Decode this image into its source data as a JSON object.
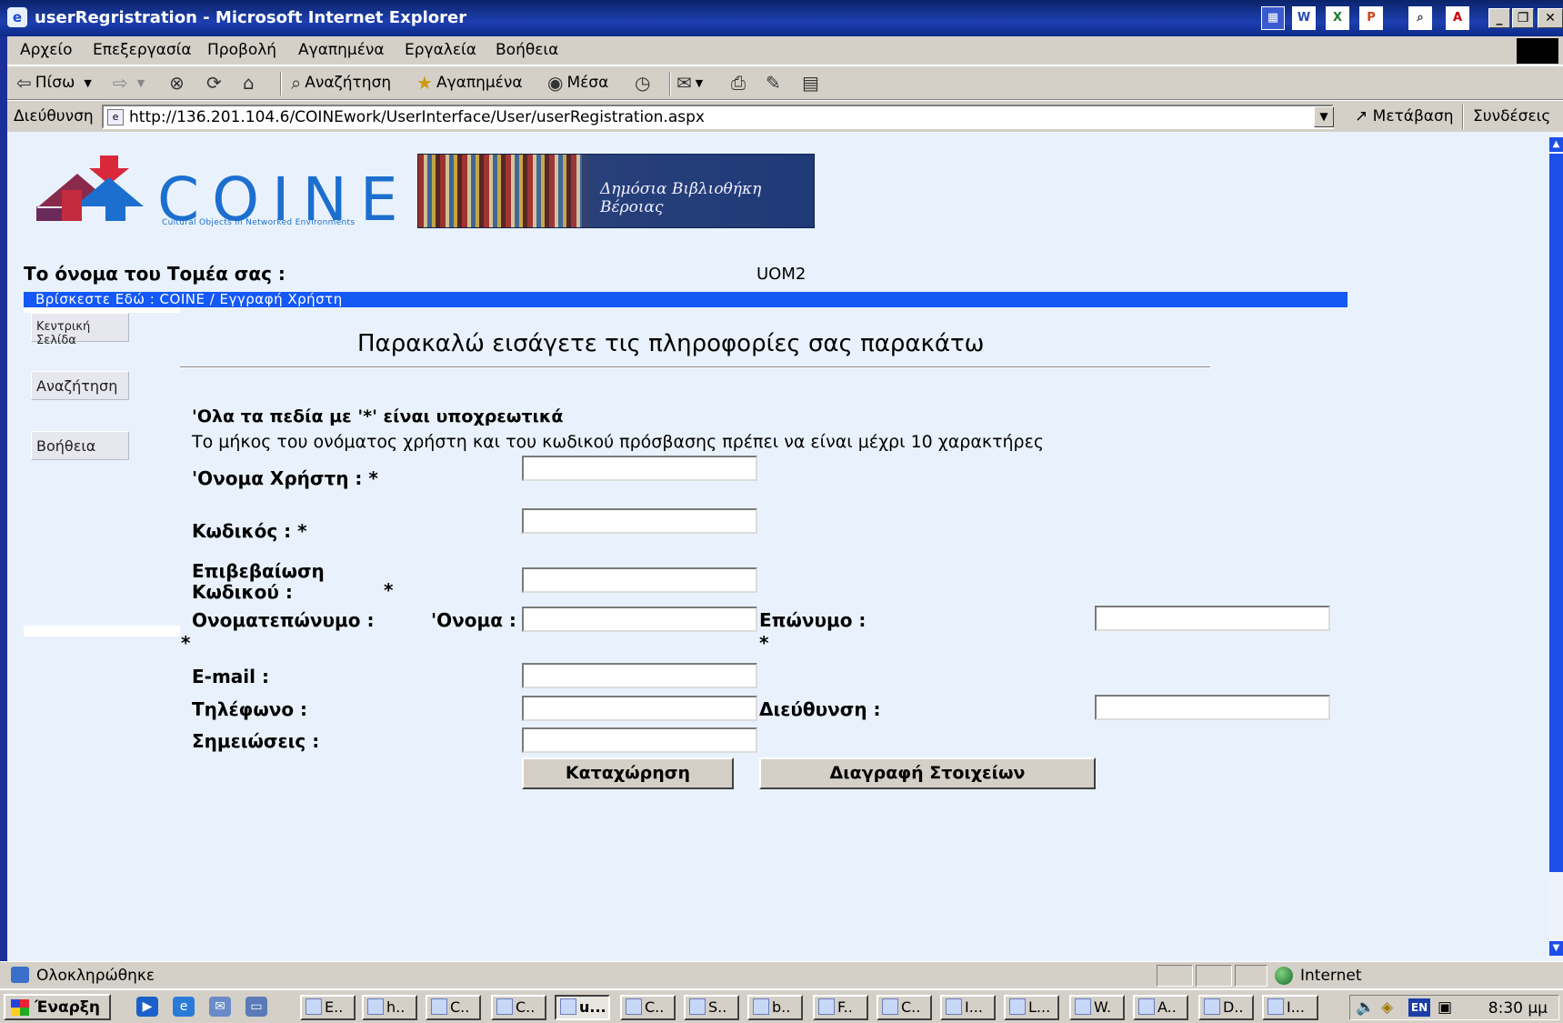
{
  "window": {
    "title": "userRegristration - Microsoft Internet Explorer"
  },
  "menu": [
    "Αρχείο",
    "Επεξεργασία",
    "Προβολή",
    "Αγαπημένα",
    "Εργαλεία",
    "Βοήθεια"
  ],
  "toolbar": {
    "back_label": "Πίσω",
    "search_label": "Αναζήτηση",
    "favorites_label": "Αγαπημένα",
    "media_label": "Μέσα"
  },
  "address": {
    "label": "Διεύθυνση",
    "url": "http://136.201.104.6/COINEwork/UserInterface/User/userRegistration.aspx",
    "go_label": "Μετάβαση",
    "links_label": "Συνδέσεις"
  },
  "page": {
    "logo_text": "COINE",
    "logo_subtitle": "Cultural Objects in Networked Environments",
    "banner_text": "Δημόσια Βιβλιοθήκη Βέροιας",
    "sector_label": "Το όνομα του Τομέα σας :",
    "sector_value": "UOM2",
    "breadcrumb": "Βρίσκεστε Εδώ : COINE / Εγγραφή Χρήστη",
    "side_menu": [
      "Κεντρική Σελίδα",
      "Αναζήτηση",
      "Βοήθεια"
    ],
    "heading": "Παρακαλώ εισάγετε τις πληροφορίες σας παρακάτω",
    "required_note": "'Ολα τα πεδία με '*' είναι υποχρεωτικά",
    "length_note": "Το μήκος του ονόματος χρήστη και του κωδικού πρόσβασης πρέπει να είναι μέχρι 10 χαρακτήρες",
    "form": {
      "username_label": "'Ονομα Χρήστη : *",
      "password_label": "Κωδικός : *",
      "confirm_label_1": "Επιβεβαίωση",
      "confirm_label_2": "Κωδικού :",
      "fullname_label": "Ονοματεπώνυμο :",
      "firstname_label": "'Ονομα :",
      "lastname_label": "Επώνυμο :",
      "email_label": "E-mail :",
      "phone_label": "Τηλέφωνο :",
      "address_label": "Διεύθυνση :",
      "notes_label": "Σημειώσεις :",
      "required_mark": "*",
      "values": {
        "username": "",
        "password": "",
        "confirm": "",
        "firstname": "",
        "lastname": "",
        "email": "",
        "phone": "",
        "address": "",
        "notes": ""
      }
    },
    "submit_label": "Καταχώρηση",
    "clear_label": "Διαγραφή Στοιχείων"
  },
  "status": {
    "text": "Ολοκληρώθηκε",
    "zone": "Internet"
  },
  "taskbar": {
    "start_label": "Έναρξη",
    "tasks": [
      "E..",
      "h..",
      "C..",
      "C..",
      "u...",
      "C..",
      "S..",
      "b..",
      "F..",
      "C..",
      "I...",
      "L...",
      "W.",
      "A..",
      "D..",
      "I..."
    ],
    "lang": "EN",
    "clock": "8:30 μμ"
  },
  "colors": {
    "page_background": "#e9f2fc",
    "breadcrumb_bar": "#1458f5",
    "title_bar": "#0a246a",
    "chrome": "#d4d0c8",
    "logo_blue": "#1d6fcf",
    "logo_red": "#d8283a"
  },
  "icons": [
    "ie-icon",
    "back-icon",
    "forward-icon",
    "stop-icon",
    "refresh-icon",
    "home-icon",
    "search-icon",
    "favorites-icon",
    "media-icon",
    "history-icon",
    "mail-icon",
    "print-icon",
    "edit-icon",
    "discuss-icon",
    "page-icon",
    "go-icon",
    "globe-icon",
    "windows-flag-icon"
  ]
}
